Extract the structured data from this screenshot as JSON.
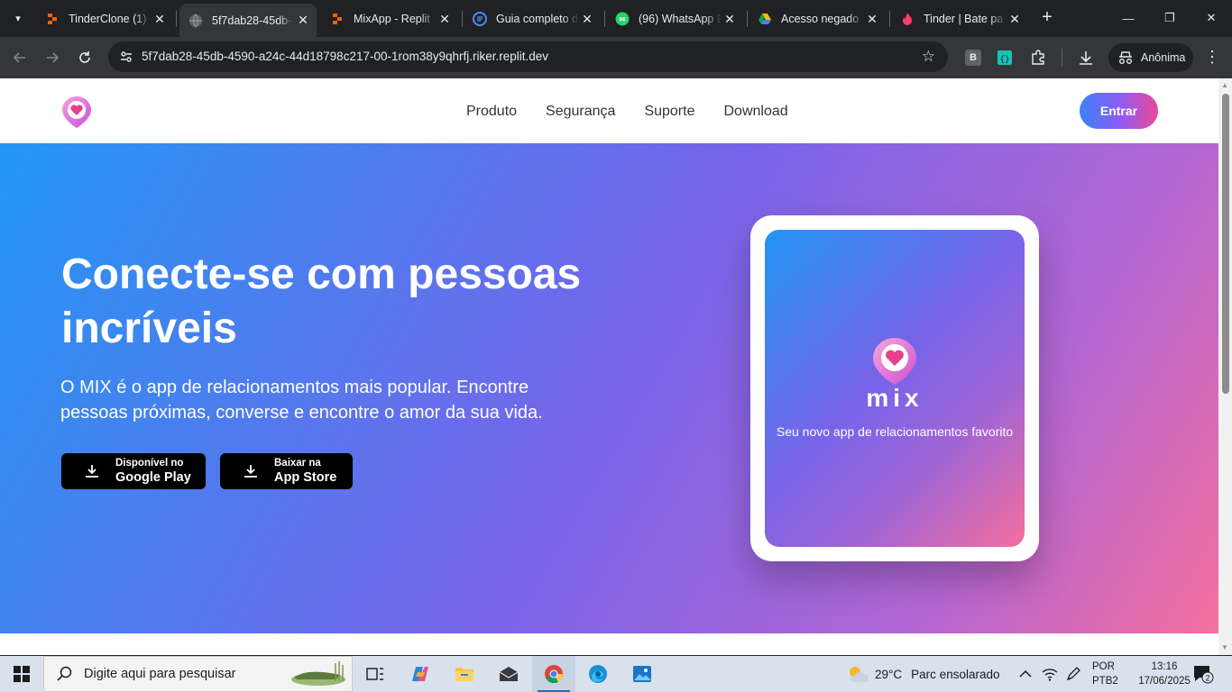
{
  "browser": {
    "tabs": [
      {
        "title": "TinderClone (1) -",
        "icon": "replit-icon"
      },
      {
        "title": "5f7dab28-45db-",
        "icon": "globe-icon",
        "active": true
      },
      {
        "title": "MixApp - Replit",
        "icon": "replit-icon"
      },
      {
        "title": "Guia completo d",
        "icon": "docs-icon"
      },
      {
        "title": "(96) WhatsApp B",
        "icon": "whatsapp-icon",
        "badge": "96"
      },
      {
        "title": "Acesso negado",
        "icon": "drive-icon"
      },
      {
        "title": "Tinder | Bate pa",
        "icon": "tinder-icon"
      }
    ],
    "url": "5f7dab28-45db-4590-a24c-44d18798c217-00-1rom38y9qhrfj.riker.replit.dev",
    "extension_b_label": "B",
    "incognito_label": "Anônima"
  },
  "site": {
    "nav": [
      "Produto",
      "Segurança",
      "Suporte",
      "Download"
    ],
    "login_label": "Entrar",
    "hero_title": "Conecte-se com pessoas incríveis",
    "hero_text": "O MIX é o app de relacionamentos mais popular. Encontre pessoas próximas, converse e encontre o amor da sua vida.",
    "google_play": {
      "line1": "Disponível no",
      "line2": "Google Play"
    },
    "app_store": {
      "line1": "Baixar na",
      "line2": "App Store"
    },
    "phone_brand": "mix",
    "phone_tagline": "Seu novo app de relacionamentos favorito"
  },
  "taskbar": {
    "search_placeholder": "Digite aqui para pesquisar",
    "weather_temp": "29°C",
    "weather_text": "Parc ensolarado",
    "lang_line1": "POR",
    "lang_line2": "PTB2",
    "time": "13:16",
    "date": "17/06/2025",
    "notification_count": "2"
  },
  "colors": {
    "accent_blue": "#2196f3",
    "accent_purple": "#7764ea",
    "accent_pink": "#f56f9e"
  }
}
